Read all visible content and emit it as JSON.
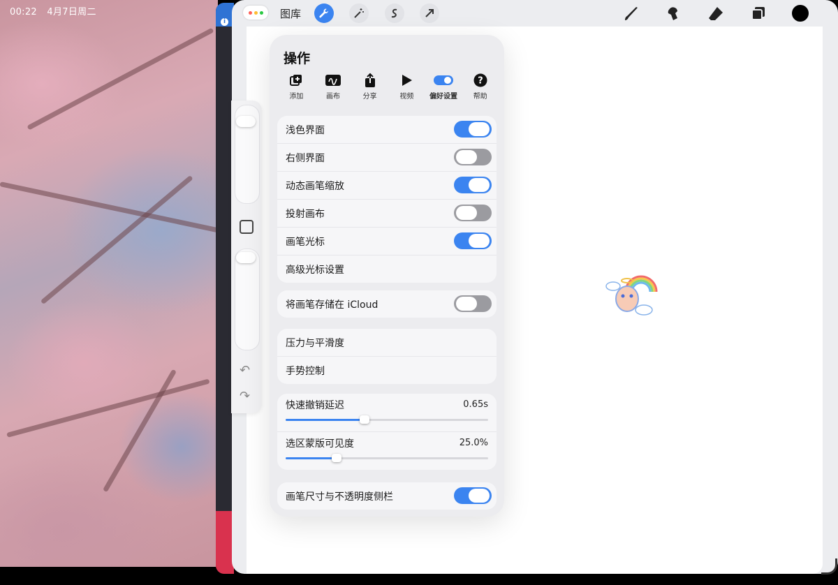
{
  "status_bar": {
    "time": "00:22",
    "date": "4月7日周二"
  },
  "toolbar": {
    "gallery_label": "图库",
    "icons": [
      "wrench-icon",
      "magic-wand-icon",
      "selection-icon",
      "transform-arrow-icon"
    ],
    "tools": [
      "brush-icon",
      "smudge-icon",
      "eraser-icon",
      "layers-icon"
    ],
    "current_color": "#000000"
  },
  "actions_panel": {
    "title": "操作",
    "tabs": [
      {
        "label": "添加",
        "icon": "add-icon",
        "selected": false
      },
      {
        "label": "画布",
        "icon": "canvas-icon",
        "selected": false
      },
      {
        "label": "分享",
        "icon": "share-icon",
        "selected": false
      },
      {
        "label": "视频",
        "icon": "play-icon",
        "selected": false
      },
      {
        "label": "偏好设置",
        "icon": "toggle-icon",
        "selected": true
      },
      {
        "label": "帮助",
        "icon": "help-icon",
        "selected": false
      }
    ],
    "group1": [
      {
        "label": "浅色界面",
        "on": true
      },
      {
        "label": "右侧界面",
        "on": false
      },
      {
        "label": "动态画笔缩放",
        "on": true
      },
      {
        "label": "投射画布",
        "on": false
      },
      {
        "label": "画笔光标",
        "on": true
      },
      {
        "label": "高级光标设置"
      }
    ],
    "group2": [
      {
        "label": "将画笔存储在 iCloud",
        "on": false
      }
    ],
    "group3": [
      {
        "label": "压力与平滑度"
      },
      {
        "label": "手势控制"
      }
    ],
    "sliders": [
      {
        "label": "快速撤销延迟",
        "value": "0.65s",
        "fraction": 0.39
      },
      {
        "label": "选区蒙版可见度",
        "value": "25.0%",
        "fraction": 0.25
      }
    ],
    "group5": [
      {
        "label": "画笔尺寸与不透明度侧栏",
        "on": true
      }
    ]
  },
  "colors": {
    "accent": "#3b84f0",
    "toggle_off": "#9b9ba0"
  }
}
